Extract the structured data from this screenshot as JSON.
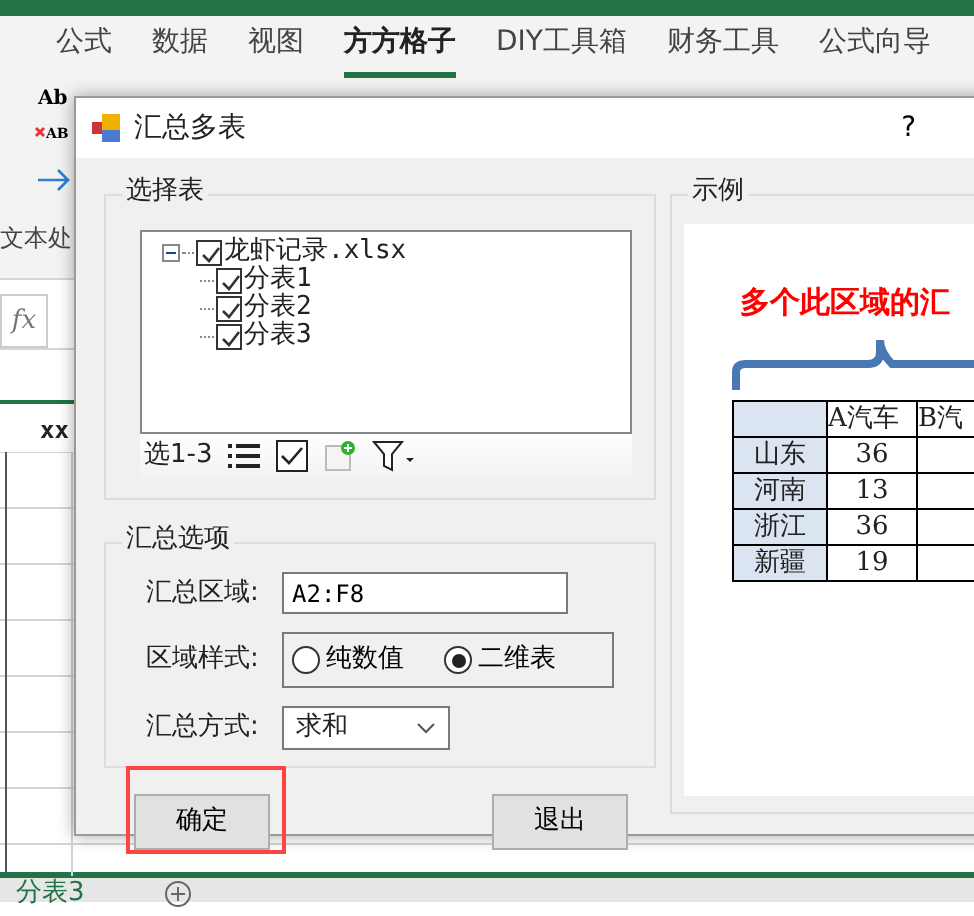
{
  "ribbon": {
    "tabs": [
      {
        "label": "公式",
        "selected": false
      },
      {
        "label": "数据",
        "selected": false
      },
      {
        "label": "视图",
        "selected": false
      },
      {
        "label": "方方格子",
        "selected": true
      },
      {
        "label": "DIY工具箱",
        "selected": false
      },
      {
        "label": "财务工具",
        "selected": false
      },
      {
        "label": "公式向导",
        "selected": false
      }
    ],
    "tool_labels": [
      "Ab",
      "AB"
    ],
    "group_label": "文本处"
  },
  "formula_bar": {
    "function_label": "fx"
  },
  "sheet": {
    "header_cell": "xx",
    "sheet_tabs": [
      {
        "label": "分表3",
        "selected": true
      }
    ]
  },
  "dialog": {
    "title": "汇总多表",
    "help": "?",
    "select_group": {
      "title": "选择表",
      "tree": [
        {
          "label": "龙虾记录.xlsx",
          "checked": true,
          "expanded": true,
          "children": [
            {
              "label": "分表1",
              "checked": true
            },
            {
              "label": "分表2",
              "checked": true
            },
            {
              "label": "分表3",
              "checked": true
            }
          ]
        }
      ],
      "toolbar_label": "选1-3"
    },
    "options_group": {
      "title": "汇总选项",
      "range": {
        "label": "汇总区域:",
        "value": "A2:F8"
      },
      "style": {
        "label": "区域样式:",
        "options": [
          {
            "label": "纯数值",
            "selected": false
          },
          {
            "label": "二维表",
            "selected": true
          }
        ]
      },
      "method": {
        "label": "汇总方式:",
        "value": "求和"
      }
    },
    "example": {
      "title": "示例",
      "caption": "多个此区域的汇",
      "table": {
        "columns": [
          "A汽车",
          "B汽"
        ],
        "rows": [
          {
            "region": "山东",
            "column_2": "36"
          },
          {
            "region": "河南",
            "column_2": "13"
          },
          {
            "region": "浙江",
            "column_2": "36"
          },
          {
            "region": "新疆",
            "column_2": "19"
          }
        ]
      }
    },
    "buttons": [
      {
        "label": "确定",
        "highlighted": true
      },
      {
        "label": "退出",
        "highlighted": false
      }
    ]
  }
}
